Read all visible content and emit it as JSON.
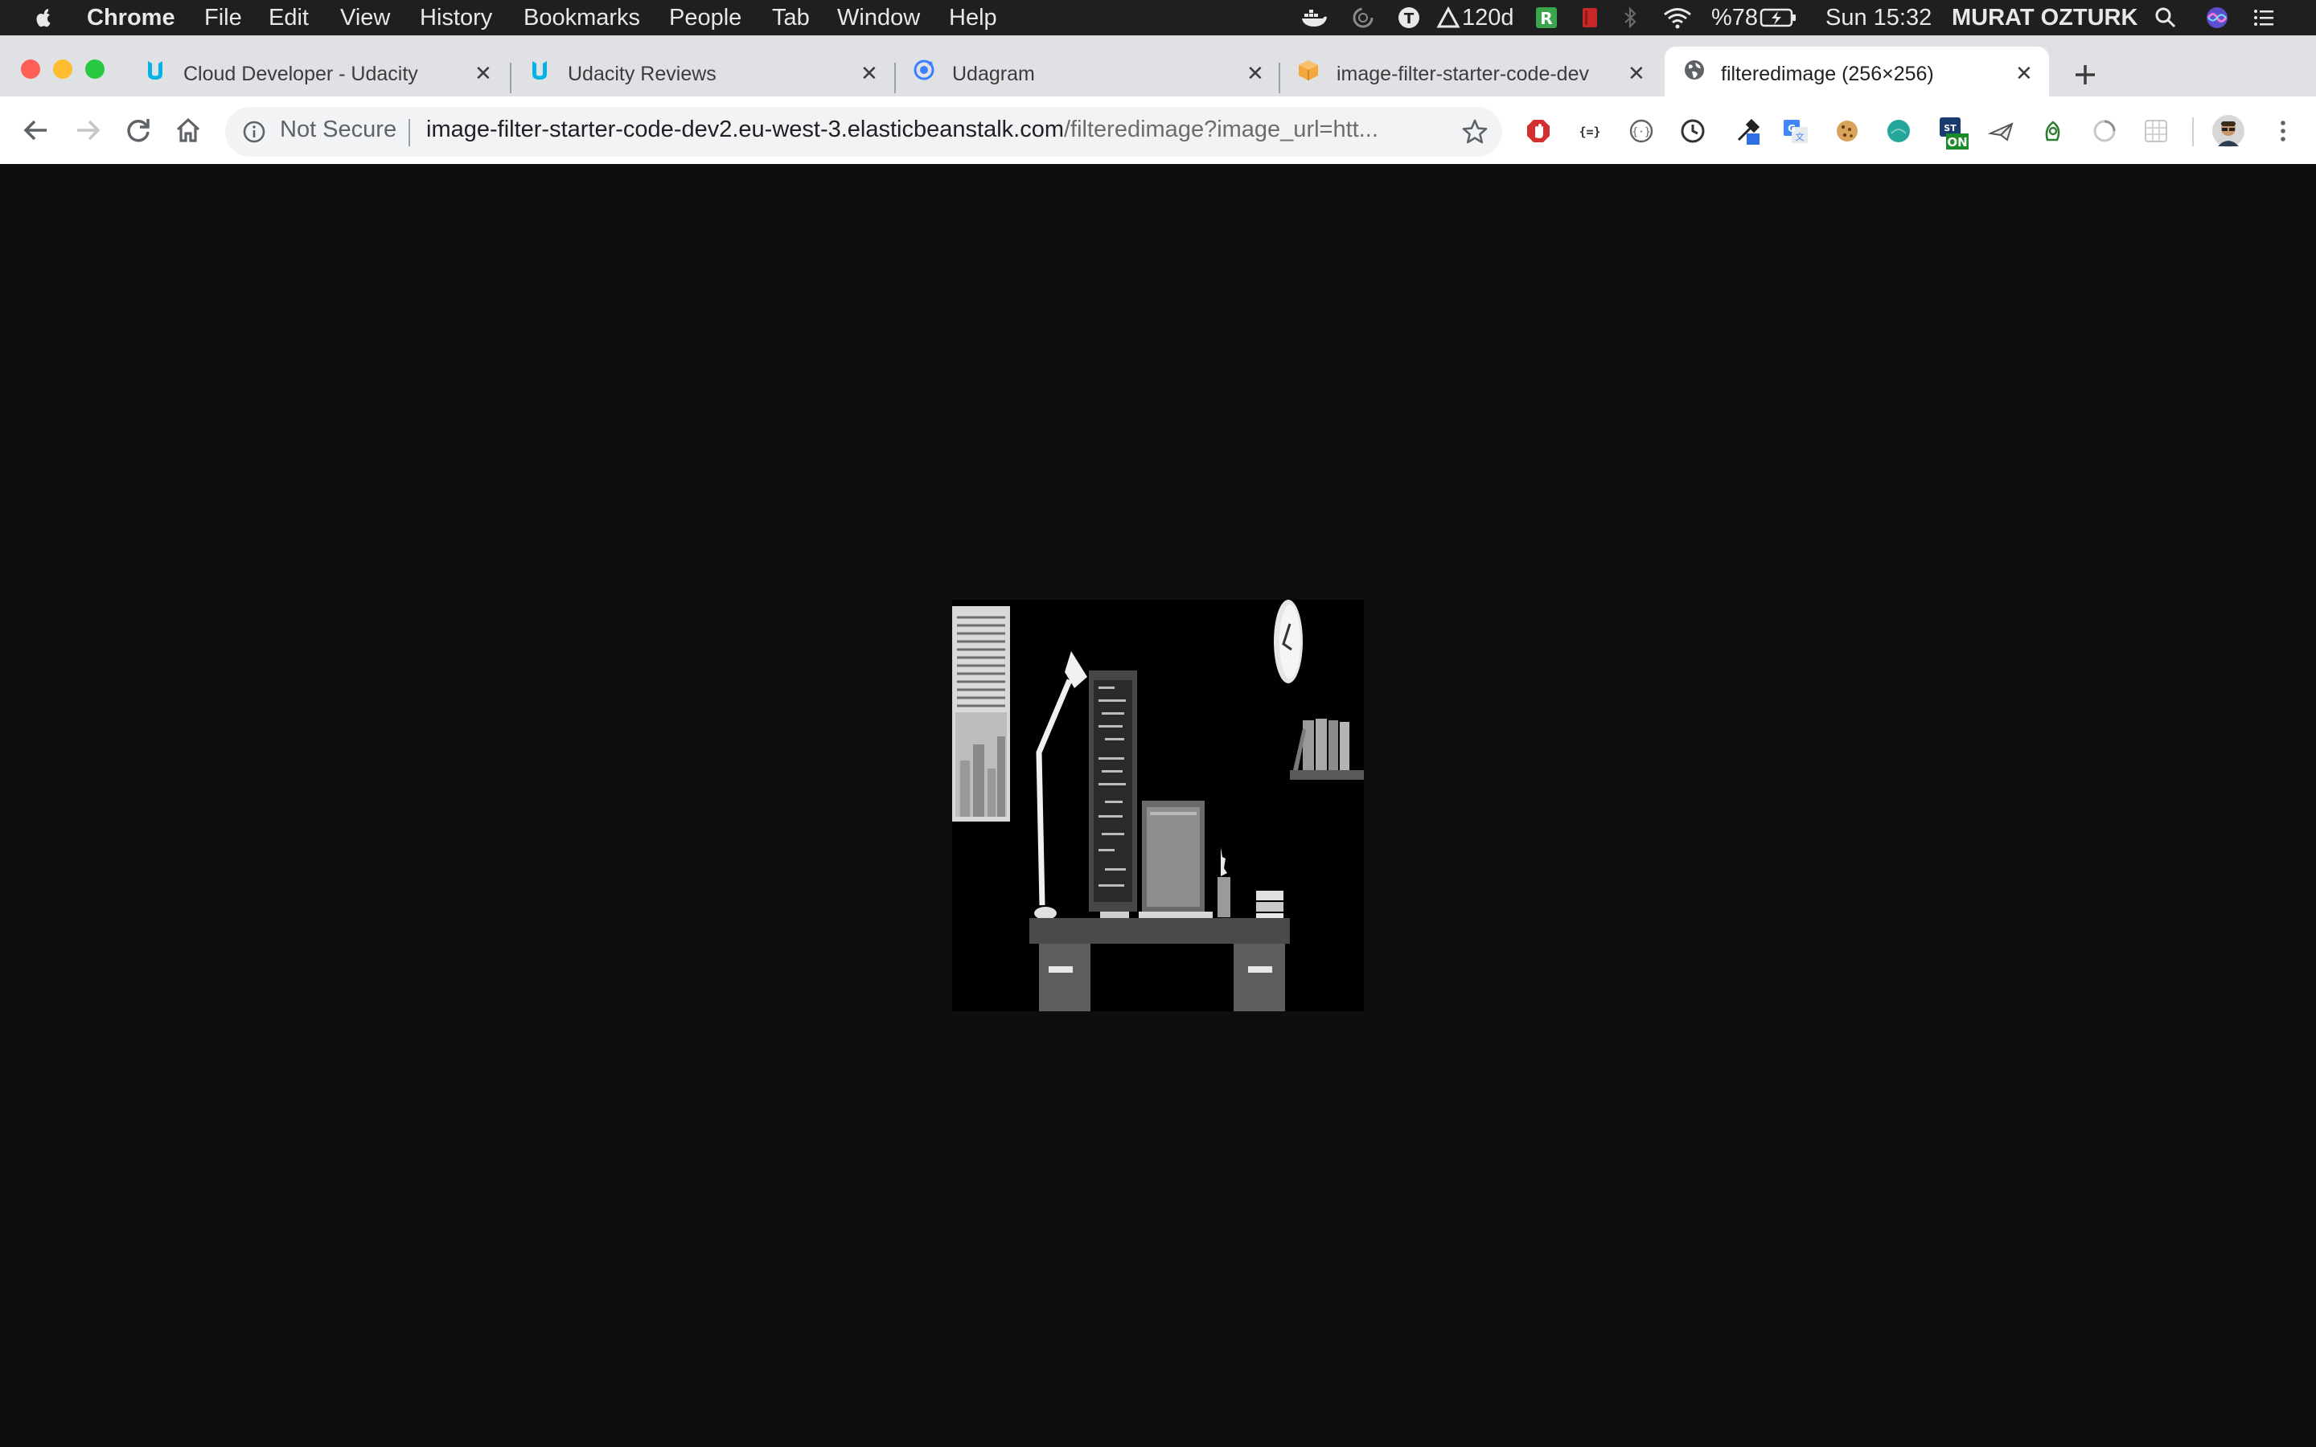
{
  "menubar": {
    "app_name": "Chrome",
    "menus": [
      "File",
      "Edit",
      "View",
      "History",
      "Bookmarks",
      "People",
      "Tab",
      "Window",
      "Help"
    ],
    "status": {
      "days_counter": "120d",
      "battery_percent": "%78",
      "clock": "Sun 15:32",
      "user_name": "MURAT OZTURK"
    }
  },
  "tabs": [
    {
      "title": "Cloud Developer - Udacity",
      "icon": "udacity-icon",
      "active": false
    },
    {
      "title": "Udacity Reviews",
      "icon": "udacity-icon",
      "active": false
    },
    {
      "title": "Udagram",
      "icon": "ionic-icon",
      "active": false
    },
    {
      "title": "image-filter-starter-code-dev",
      "icon": "aws-box-icon",
      "active": false
    },
    {
      "title": "filteredimage (256×256)",
      "icon": "globe-icon",
      "active": true
    }
  ],
  "toolbar": {
    "security_label": "Not Secure",
    "url_host": "image-filter-starter-code-dev2.eu-west-3.elasticbeanstalk.com",
    "url_path": "/filteredimage?image_url=htt..."
  },
  "extensions": [
    "adblock-icon",
    "json-viewer-icon",
    "code-icon",
    "clock-history-icon",
    "eyedropper-icon",
    "google-translate-icon",
    "cookie-icon",
    "teal-circle-icon",
    "on-badge-icon",
    "paper-plane-icon",
    "leaf-icon",
    "spinner-icon",
    "grid-icon"
  ],
  "content": {
    "image_alt": "filteredimage (256×256)"
  },
  "colors": {
    "content_bg": "#0e0e0e",
    "tab_strip_bg": "#dfe1e5",
    "close_red": "#fe5f57",
    "minimize_yellow": "#febc2e",
    "zoom_green": "#28c840"
  }
}
